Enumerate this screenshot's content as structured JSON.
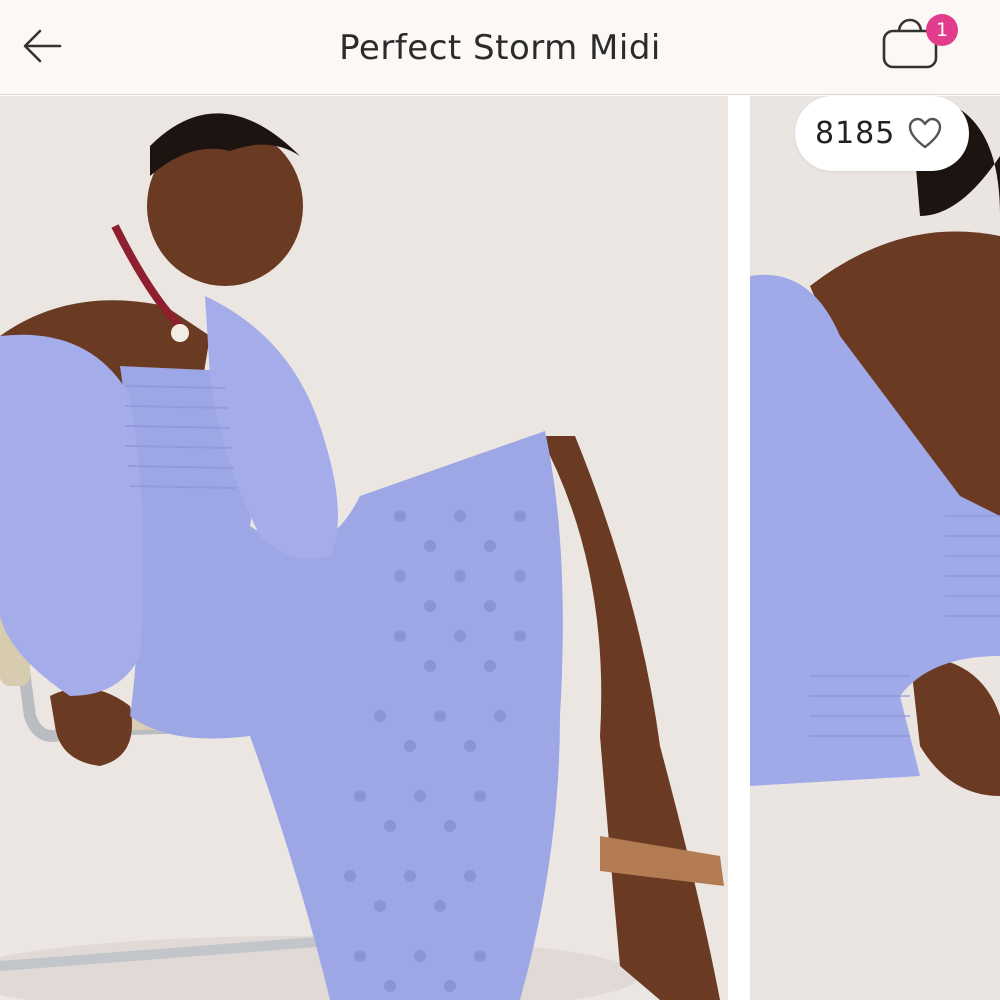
{
  "header": {
    "title": "Perfect Storm Midi",
    "back_icon": "arrow-left-icon",
    "bag_icon": "shopping-bag-icon",
    "bag_count": "1",
    "badge_color": "#e23d8c"
  },
  "gallery": {
    "likes": "8185",
    "like_icon": "heart-outline-icon",
    "images": [
      {
        "alt": "Model seated on chrome chair wearing lavender off-shoulder eyelet midi dress"
      },
      {
        "alt": "Close-up of lavender dress smocked sleeve and shoulder"
      }
    ],
    "dress_color": "#9ea7e6"
  }
}
